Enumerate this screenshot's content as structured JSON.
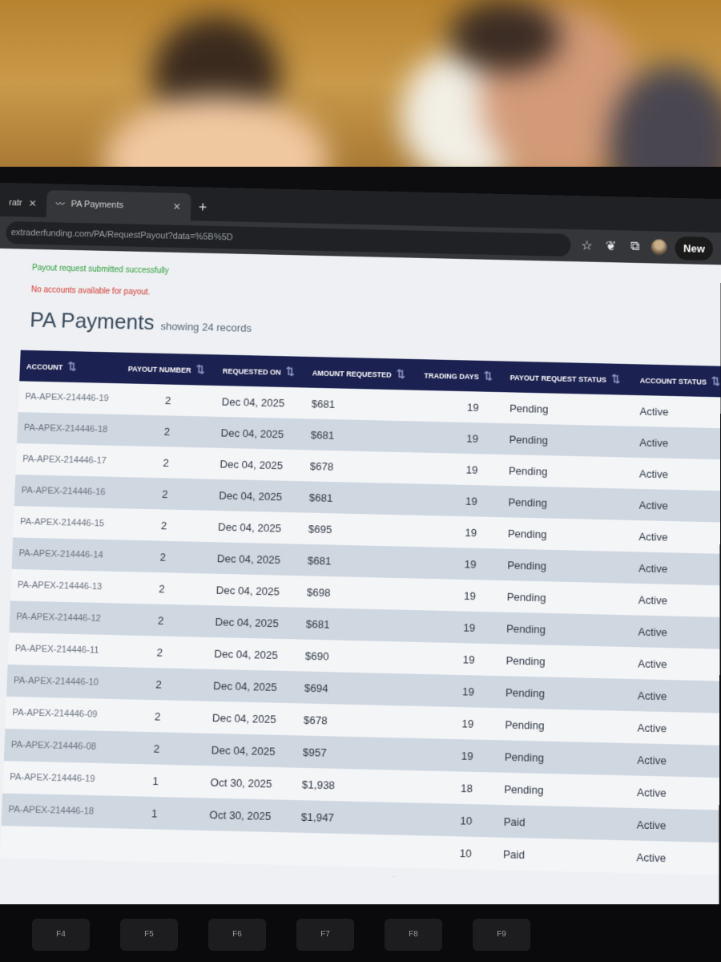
{
  "browser": {
    "tabs": [
      {
        "label": "ratr",
        "active": false
      },
      {
        "label": "PA Payments",
        "active": true
      }
    ],
    "url": "extraderfunding.com/PA/RequestPayout?data=%5B%5D",
    "new_label": "New"
  },
  "page": {
    "success_message": "Payout request submitted successfully",
    "error_message": "No accounts available for payout.",
    "title": "PA Payments",
    "subtitle": "showing 24 records"
  },
  "table": {
    "columns": [
      "Account",
      "Payout Number",
      "Requested On",
      "Amount Requested",
      "Trading Days",
      "Payout Request Status",
      "Account Status"
    ],
    "rows": [
      [
        "PA-APEX-214446-19",
        "2",
        "Dec 04, 2025",
        "$681",
        "19",
        "Pending",
        "Active"
      ],
      [
        "PA-APEX-214446-18",
        "2",
        "Dec 04, 2025",
        "$681",
        "19",
        "Pending",
        "Active"
      ],
      [
        "PA-APEX-214446-17",
        "2",
        "Dec 04, 2025",
        "$678",
        "19",
        "Pending",
        "Active"
      ],
      [
        "PA-APEX-214446-16",
        "2",
        "Dec 04, 2025",
        "$681",
        "19",
        "Pending",
        "Active"
      ],
      [
        "PA-APEX-214446-15",
        "2",
        "Dec 04, 2025",
        "$695",
        "19",
        "Pending",
        "Active"
      ],
      [
        "PA-APEX-214446-14",
        "2",
        "Dec 04, 2025",
        "$681",
        "19",
        "Pending",
        "Active"
      ],
      [
        "PA-APEX-214446-13",
        "2",
        "Dec 04, 2025",
        "$698",
        "19",
        "Pending",
        "Active"
      ],
      [
        "PA-APEX-214446-12",
        "2",
        "Dec 04, 2025",
        "$681",
        "19",
        "Pending",
        "Active"
      ],
      [
        "PA-APEX-214446-11",
        "2",
        "Dec 04, 2025",
        "$690",
        "19",
        "Pending",
        "Active"
      ],
      [
        "PA-APEX-214446-10",
        "2",
        "Dec 04, 2025",
        "$694",
        "19",
        "Pending",
        "Active"
      ],
      [
        "PA-APEX-214446-09",
        "2",
        "Dec 04, 2025",
        "$678",
        "19",
        "Pending",
        "Active"
      ],
      [
        "PA-APEX-214446-08",
        "2",
        "Dec 04, 2025",
        "$957",
        "19",
        "Pending",
        "Active"
      ],
      [
        "PA-APEX-214446-19",
        "1",
        "Oct 30, 2025",
        "$1,938",
        "18",
        "Pending",
        "Active"
      ],
      [
        "PA-APEX-214446-18",
        "1",
        "Oct 30, 2025",
        "$1,947",
        "10",
        "Paid",
        "Active"
      ],
      [
        "",
        "",
        "",
        "",
        "10",
        "Paid",
        "Active"
      ]
    ]
  },
  "keyboard": {
    "keys": [
      "F4",
      "F5",
      "F6",
      "F7",
      "F8",
      "F9"
    ]
  },
  "colors": {
    "header_bg": "#1b2150",
    "success": "#2e9e3a",
    "error": "#d2382f",
    "row_alt": "#cfd7e0"
  }
}
